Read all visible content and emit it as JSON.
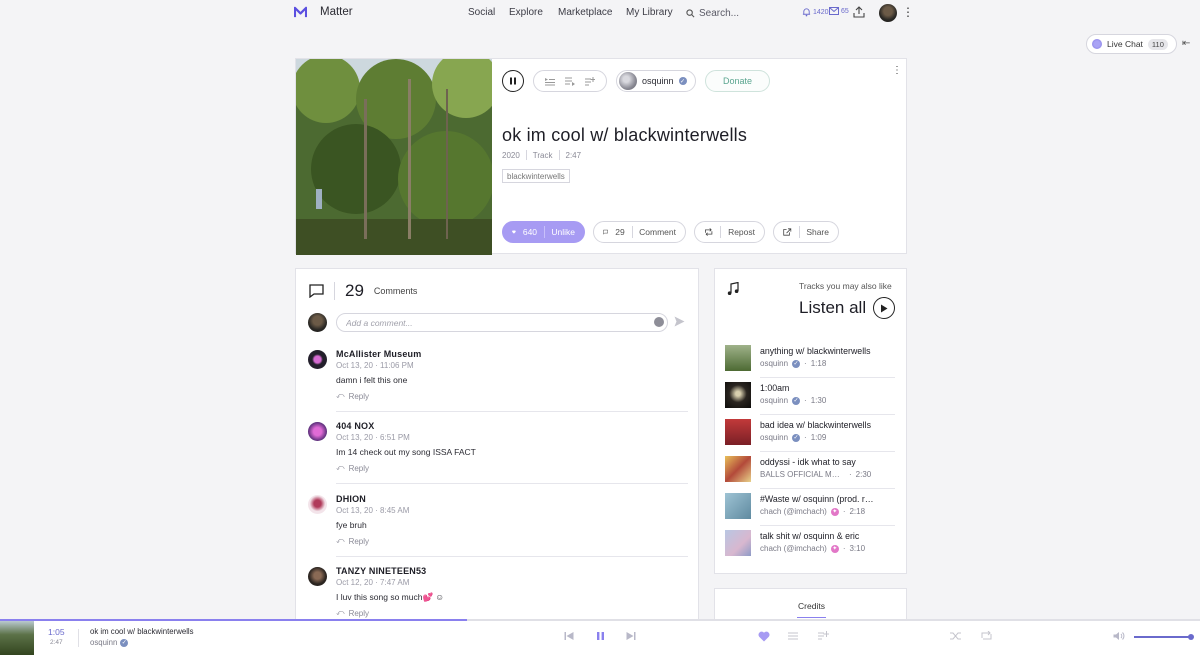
{
  "nav": {
    "brand": "Matter",
    "links": [
      "Social",
      "Explore",
      "Marketplace",
      "My Library"
    ],
    "search_placeholder": "Search...",
    "notifications_count": "1420",
    "messages_count": "65"
  },
  "live_chat": {
    "label": "Live Chat",
    "count": "110"
  },
  "track": {
    "title": "ok im cool w/ blackwinterwells",
    "year": "2020",
    "type": "Track",
    "duration": "2:47",
    "tag": "blackwinterwells",
    "artist": "osquinn",
    "donate_label": "Donate",
    "likes": "640",
    "unlike_label": "Unlike",
    "comments": "29",
    "comment_label": "Comment",
    "repost_label": "Repost",
    "share_label": "Share"
  },
  "comments_section": {
    "count": "29",
    "label": "Comments",
    "input_placeholder": "Add a comment...",
    "reply_label": "Reply",
    "items": [
      {
        "name": "McAllister Museum",
        "date": "Oct 13, 20",
        "time": "11:06 PM",
        "text": "damn i felt this one"
      },
      {
        "name": "404 NOX",
        "date": "Oct 13, 20",
        "time": "6:51 PM",
        "text": "Im 14 check out my song ISSA FACT"
      },
      {
        "name": "DHION",
        "date": "Oct 13, 20",
        "time": "8:45 AM",
        "text": "fye bruh"
      },
      {
        "name": "TANZY NINETEEN53",
        "date": "Oct 12, 20",
        "time": "7:47 AM",
        "text": "I luv this song so much💕 ☺"
      }
    ]
  },
  "recommended": {
    "label": "Tracks you may also like",
    "listen_all": "Listen all",
    "items": [
      {
        "title": "anything w/ blackwinterwells",
        "artist": "osquinn",
        "duration": "1:18",
        "badge": "verified"
      },
      {
        "title": "1:00am",
        "artist": "osquinn",
        "duration": "1:30",
        "badge": "verified"
      },
      {
        "title": "bad idea w/ blackwinterwells",
        "artist": "osquinn",
        "duration": "1:09",
        "badge": "verified"
      },
      {
        "title": "oddyssi - idk what to say",
        "artist": "BALLS OFFICIAL MUSIC",
        "duration": "2:30",
        "badge": ""
      },
      {
        "title": "#Waste w/ osquinn (prod. rossi)",
        "artist": "chach (@imchach)",
        "duration": "2:18",
        "badge": "pro"
      },
      {
        "title": "talk shit w/ osquinn & eric",
        "artist": "chach (@imchach)",
        "duration": "3:10",
        "badge": "pro"
      }
    ]
  },
  "credits": {
    "label": "Credits"
  },
  "player": {
    "current_time": "1:05",
    "duration": "2:47",
    "title": "ok im cool w/ blackwinterwells",
    "artist": "osquinn",
    "progress": 0.389,
    "volume": 1.0
  },
  "colors": {
    "accent": "#8a80ee",
    "like": "#a79bf3",
    "donate": "#5aa58f",
    "pro_badge": "#e277c7"
  }
}
